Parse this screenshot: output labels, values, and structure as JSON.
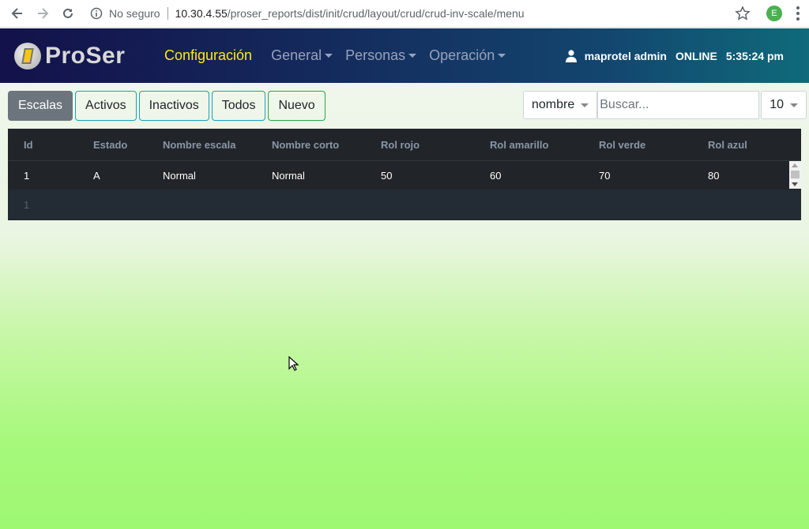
{
  "browser": {
    "security_label": "No seguro",
    "url_host": "10.30.4.55",
    "url_path": "/proser_reports/dist/init/crud/layout/crud/crud-inv-scale/menu",
    "profile_initial": "E"
  },
  "navbar": {
    "logo_text": "ProSer",
    "menu": [
      {
        "label": "Configuración",
        "active": true
      },
      {
        "label": "General"
      },
      {
        "label": "Personas"
      },
      {
        "label": "Operación"
      }
    ],
    "user": "maprotel admin",
    "status": "ONLINE",
    "time": "5:35:24 pm"
  },
  "toolbar": {
    "buttons": [
      "Escalas",
      "Activos",
      "Inactivos",
      "Todos",
      "Nuevo"
    ],
    "active_button": "Escalas"
  },
  "search": {
    "field_select": "nombre",
    "placeholder": "Buscar...",
    "page_size": "10"
  },
  "table": {
    "headers": [
      "Id",
      "Estado",
      "Nombre escala",
      "Nombre corto",
      "Rol rojo",
      "Rol amarillo",
      "Rol verde",
      "Rol azul"
    ],
    "rows": [
      [
        "1",
        "A",
        "Normal",
        "Normal",
        "50",
        "60",
        "70",
        "80"
      ]
    ],
    "pagination": "1"
  },
  "colors": {
    "accent_active_menu": "#ffeb10",
    "table_bg": "#212529",
    "button_info_border": "#17a2b8",
    "button_success_border": "#28a745"
  }
}
